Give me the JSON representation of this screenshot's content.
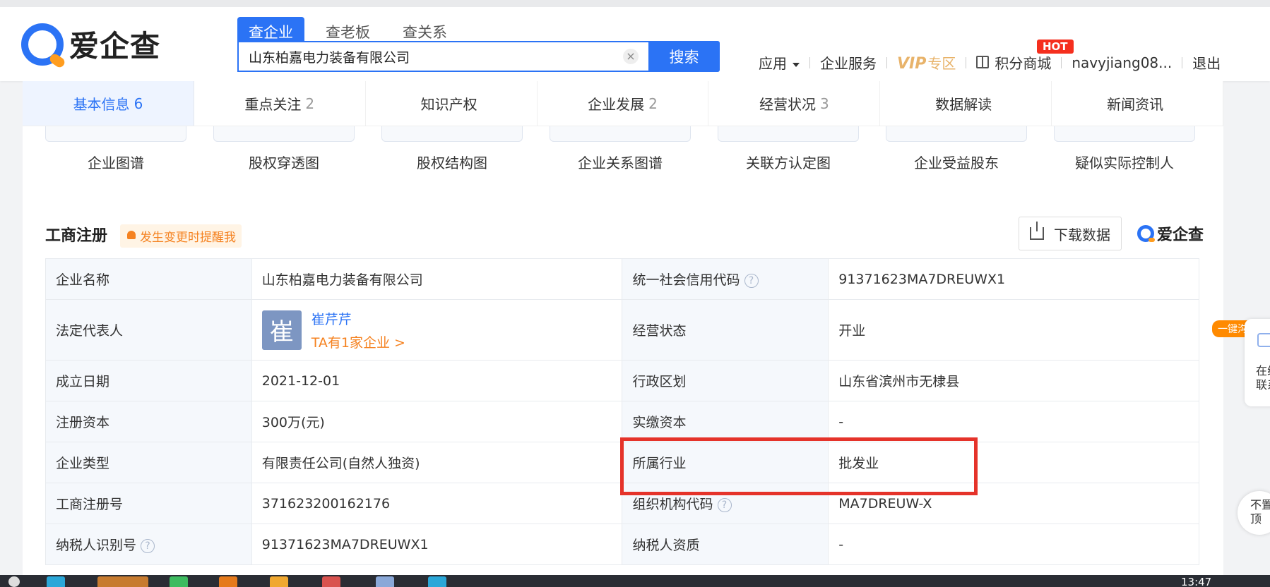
{
  "header": {
    "logo_text": "爱企查",
    "search_tabs": [
      "查企业",
      "查老板",
      "查关系"
    ],
    "search_value": "山东柏嘉电力装备有限公司",
    "search_button": "搜索",
    "nav": {
      "apps": "应用",
      "services": "企业服务",
      "vip": "VIP",
      "vip_zone": "专区",
      "points_mall": "积分商城",
      "hot_badge": "HOT",
      "username": "navyjiang08...",
      "logout": "退出"
    }
  },
  "tabs": [
    {
      "label": "基本信息",
      "count": "6"
    },
    {
      "label": "重点关注",
      "count": "2"
    },
    {
      "label": "知识产权",
      "count": ""
    },
    {
      "label": "企业发展",
      "count": "2"
    },
    {
      "label": "经营状况",
      "count": "3"
    },
    {
      "label": "数据解读",
      "count": ""
    },
    {
      "label": "新闻资讯",
      "count": ""
    }
  ],
  "graphs": [
    "企业图谱",
    "股权穿透图",
    "股权结构图",
    "企业关系图谱",
    "关联方认定图",
    "企业受益股东",
    "疑似实际控制人"
  ],
  "section": {
    "title": "工商注册",
    "remind": "发生变更时提醒我",
    "download": "下载数据",
    "brand": "爱企查"
  },
  "registration": {
    "company_name_label": "企业名称",
    "company_name": "山东柏嘉电力装备有限公司",
    "credit_code_label": "统一社会信用代码",
    "credit_code": "91371623MA7DREUWX1",
    "legal_rep_label": "法定代表人",
    "legal_rep_avatar": "崔",
    "legal_rep_name": "崔芹芹",
    "legal_rep_companies": "TA有1家企业 >",
    "status_label": "经营状态",
    "status": "开业",
    "founded_label": "成立日期",
    "founded": "2021-12-01",
    "region_label": "行政区划",
    "region": "山东省滨州市无棣县",
    "reg_capital_label": "注册资本",
    "reg_capital": "300万(元)",
    "paid_capital_label": "实缴资本",
    "paid_capital": "-",
    "type_label": "企业类型",
    "type": "有限责任公司(自然人独资)",
    "industry_label": "所属行业",
    "industry": "批发业",
    "reg_no_label": "工商注册号",
    "reg_no": "371623200162176",
    "org_code_label": "组织机构代码",
    "org_code": "MA7DREUW-X",
    "taxpayer_id_label": "纳税人识别号",
    "taxpayer_id": "91371623MA7DREUWX1",
    "taxpayer_qual_label": "纳税人资质",
    "taxpayer_qual": "-"
  },
  "float": {
    "tag": "一键沟通",
    "panel_text": "在线联系",
    "top_text": "不置顶"
  },
  "taskbar": {
    "clock": "13:47"
  }
}
